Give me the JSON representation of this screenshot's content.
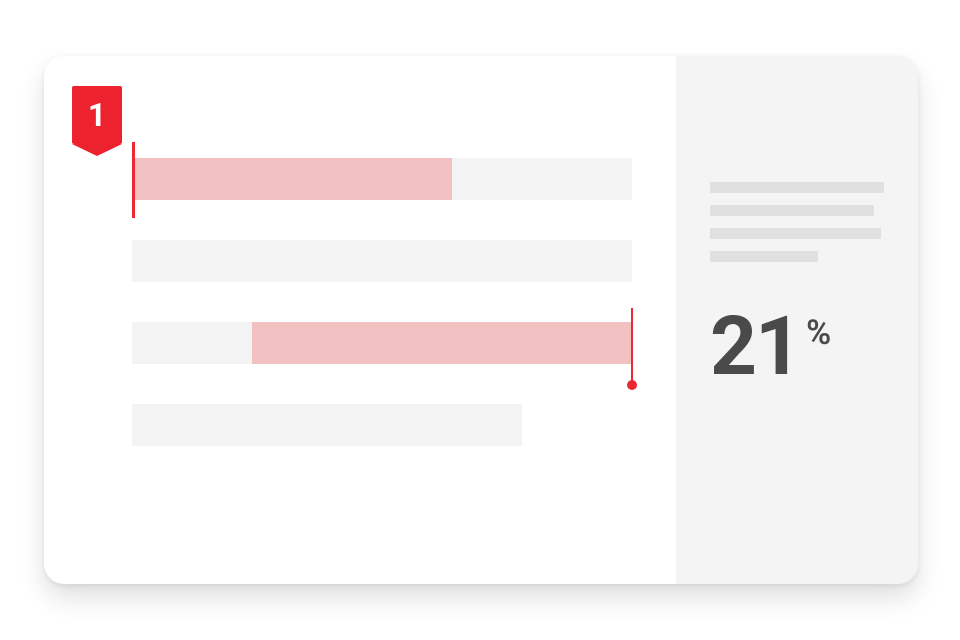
{
  "badge": {
    "number": "1"
  },
  "stat": {
    "value": "21",
    "unit": "%"
  }
}
